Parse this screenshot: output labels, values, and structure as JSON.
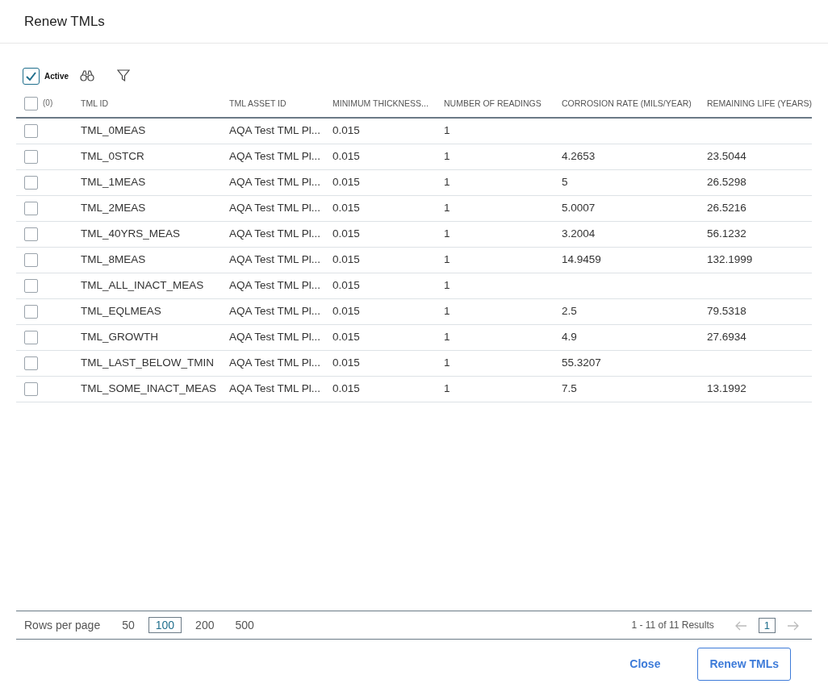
{
  "dialog": {
    "title": "Renew TMLs"
  },
  "toolbar": {
    "active_filter": {
      "label": "Active",
      "checked": true
    }
  },
  "table": {
    "select_all": {
      "count": "(0)",
      "checked": false
    },
    "columns": [
      "TML ID",
      "TML ASSET ID",
      "MINIMUM THICKNESS...",
      "NUMBER OF READINGS",
      "CORROSION RATE (MILS/YEAR)",
      "REMAINING LIFE (YEARS)"
    ],
    "rows": [
      {
        "checked": false,
        "cells": [
          "TML_0MEAS",
          "AQA Test TML Pl...",
          "0.015",
          "1",
          "",
          ""
        ]
      },
      {
        "checked": false,
        "cells": [
          "TML_0STCR",
          "AQA Test TML Pl...",
          "0.015",
          "1",
          "4.2653",
          "23.5044"
        ]
      },
      {
        "checked": false,
        "cells": [
          "TML_1MEAS",
          "AQA Test TML Pl...",
          "0.015",
          "1",
          "5",
          "26.5298"
        ]
      },
      {
        "checked": false,
        "cells": [
          "TML_2MEAS",
          "AQA Test TML Pl...",
          "0.015",
          "1",
          "5.0007",
          "26.5216"
        ]
      },
      {
        "checked": false,
        "cells": [
          "TML_40YRS_MEAS",
          "AQA Test TML Pl...",
          "0.015",
          "1",
          "3.2004",
          "56.1232"
        ]
      },
      {
        "checked": false,
        "cells": [
          "TML_8MEAS",
          "AQA Test TML Pl...",
          "0.015",
          "1",
          "14.9459",
          "132.1999"
        ]
      },
      {
        "checked": false,
        "cells": [
          "TML_ALL_INACT_MEAS",
          "AQA Test TML Pl...",
          "0.015",
          "1",
          "",
          ""
        ]
      },
      {
        "checked": false,
        "cells": [
          "TML_EQLMEAS",
          "AQA Test TML Pl...",
          "0.015",
          "1",
          "2.5",
          "79.5318"
        ]
      },
      {
        "checked": false,
        "cells": [
          "TML_GROWTH",
          "AQA Test TML Pl...",
          "0.015",
          "1",
          "4.9",
          "27.6934"
        ]
      },
      {
        "checked": false,
        "cells": [
          "TML_LAST_BELOW_TMIN",
          "AQA Test TML Pl...",
          "0.015",
          "1",
          "55.3207",
          ""
        ]
      },
      {
        "checked": false,
        "cells": [
          "TML_SOME_INACT_MEAS",
          "AQA Test TML Pl...",
          "0.015",
          "1",
          "7.5",
          "13.1992"
        ]
      }
    ]
  },
  "pagination": {
    "rows_per_page_label": "Rows per page",
    "page_sizes": [
      {
        "label": "50",
        "selected": false
      },
      {
        "label": "100",
        "selected": true
      },
      {
        "label": "200",
        "selected": false
      },
      {
        "label": "500",
        "selected": false
      }
    ],
    "range": "1 - 11 of 11 Results",
    "prev_disabled": true,
    "page": "1",
    "next_disabled": true
  },
  "buttons": [
    {
      "label": "Close",
      "kind": "link"
    },
    {
      "label": "Renew TMLs",
      "kind": "outline"
    }
  ]
}
